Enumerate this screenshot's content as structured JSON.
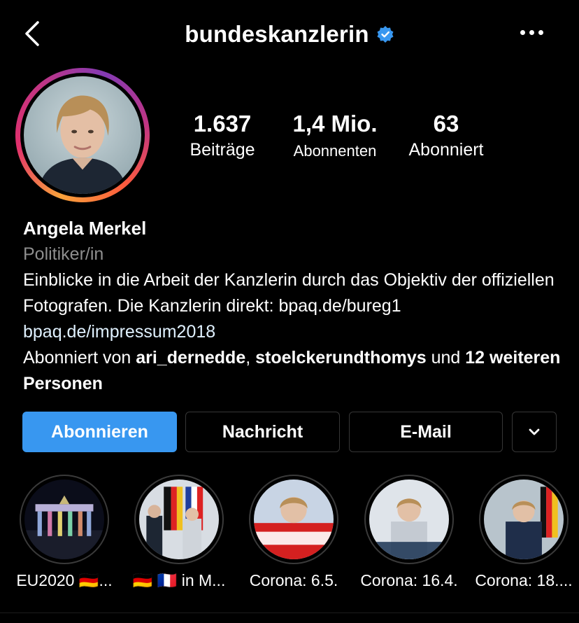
{
  "header": {
    "username": "bundeskanzlerin",
    "verified_icon": "verified-badge-icon",
    "back_icon": "chevron-left-icon",
    "more_icon": "more-horizontal-icon"
  },
  "stats": {
    "posts_value": "1.637",
    "posts_label": "Beiträge",
    "followers_value": "1,4 Mio.",
    "followers_label": "Abonnenten",
    "following_value": "63",
    "following_label": "Abonniert"
  },
  "bio": {
    "name": "Angela Merkel",
    "category": "Politiker/in",
    "text": "Einblicke in die Arbeit der Kanzlerin durch das Objektiv der offiziellen Fotografen. Die Kanzlerin direkt: bpaq.de/bureg1",
    "link": "bpaq.de/impressum2018",
    "followed_by_prefix": "Abonniert von ",
    "follower1": "ari_dernedde",
    "separator": ", ",
    "follower2": "stoelckerundthomys",
    "and_text": " und ",
    "others": "12 weiteren Personen"
  },
  "buttons": {
    "follow": "Abonnieren",
    "message": "Nachricht",
    "email": "E-Mail",
    "more_icon": "chevron-down-icon"
  },
  "highlights": [
    {
      "label": "EU2020 🇩🇪..."
    },
    {
      "label": "🇩🇪 🇫🇷 in M..."
    },
    {
      "label": "Corona: 6.5."
    },
    {
      "label": "Corona: 16.4."
    },
    {
      "label": "Corona: 18...."
    }
  ],
  "colors": {
    "background": "#000000",
    "accent": "#3897f0",
    "verified": "#3897f0",
    "muted": "#8e8e8e",
    "link": "#e0f1ff"
  }
}
